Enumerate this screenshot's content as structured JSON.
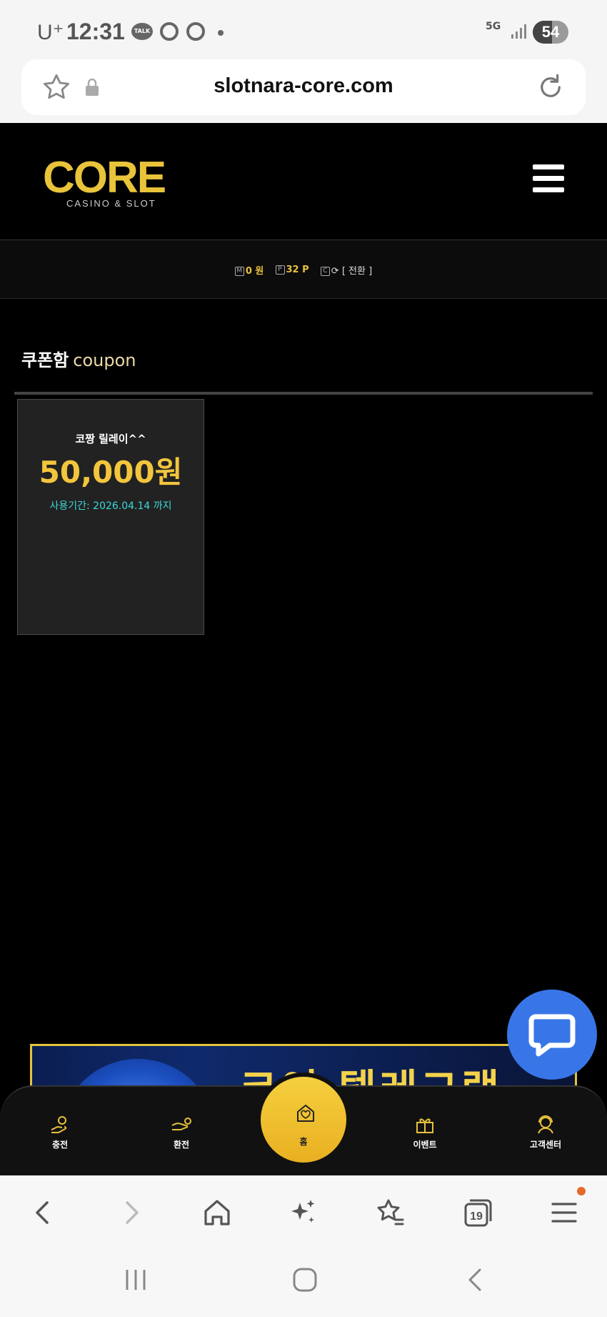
{
  "status_bar": {
    "carrier": "U⁺",
    "time": "12:31",
    "talk_badge": "TALK",
    "network": "5G",
    "battery": "54",
    "battery_level": 0.54
  },
  "address_bar": {
    "url": "slotnara-core.com"
  },
  "header": {
    "logo_word": "CORE",
    "logo_sub": "CASINO & SLOT"
  },
  "info_bar": {
    "money_icon": "M",
    "money": "0 원",
    "point_icon": "P",
    "points": "32 P",
    "convert_icon": "C",
    "convert_label": "[ 전환 ]"
  },
  "section": {
    "title_ko": "쿠폰함",
    "title_en": "coupon"
  },
  "coupons": [
    {
      "name": "코짱 릴레이^^",
      "amount": "50,000원",
      "period": "사용기간: 2026.04.14 까지"
    }
  ],
  "banner": {
    "text": "코어 텔레그램"
  },
  "bottom_nav": {
    "items": [
      {
        "label": "충전",
        "icon": "deposit-icon"
      },
      {
        "label": "환전",
        "icon": "withdraw-icon"
      },
      {
        "label": "홈",
        "icon": "home-heart-icon"
      },
      {
        "label": "이벤트",
        "icon": "gift-icon"
      },
      {
        "label": "고객센터",
        "icon": "support-icon"
      }
    ]
  },
  "browser_toolbar": {
    "tabs_count": "19"
  },
  "colors": {
    "accent_gold": "#f2c53d",
    "period_cyan": "#3dd8d8",
    "chat_blue": "#3876e8",
    "background": "#000000"
  }
}
